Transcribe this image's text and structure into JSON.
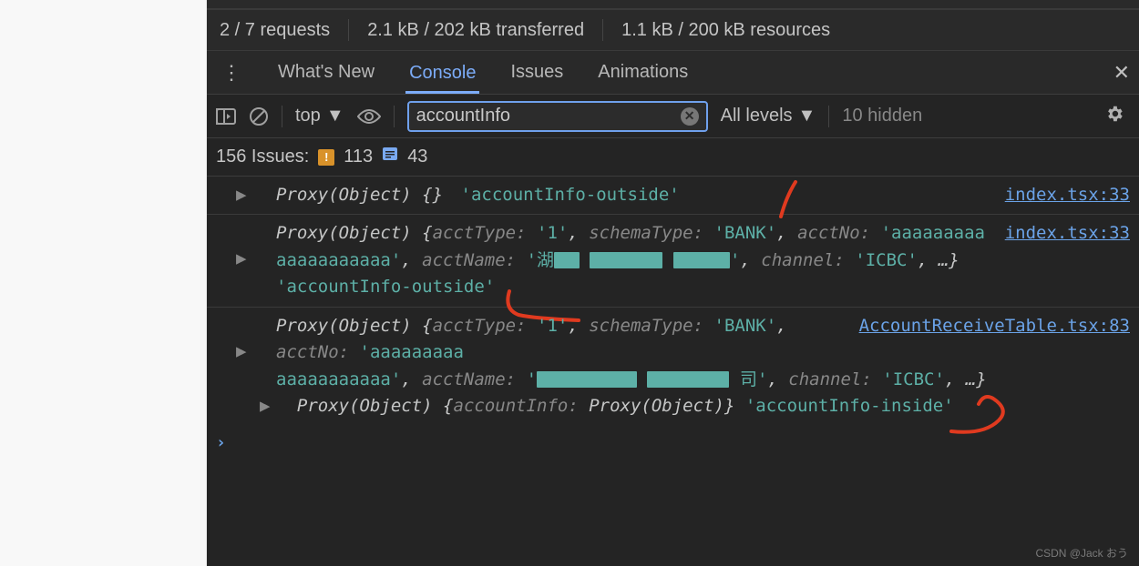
{
  "network_summary": {
    "requests": "2 / 7 requests",
    "transferred": "2.1 kB / 202 kB transferred",
    "resources": "1.1 kB / 200 kB resources"
  },
  "tabs": {
    "whats_new": "What's New",
    "console": "Console",
    "issues": "Issues",
    "animations": "Animations"
  },
  "toolbar": {
    "context": "top",
    "filter_value": "accountInfo",
    "levels": "All levels",
    "hidden": "10 hidden"
  },
  "issues_bar": {
    "label": "156 Issues:",
    "warn_count": "113",
    "info_count": "43"
  },
  "logs": {
    "row1": {
      "proxy": "Proxy(Object) ",
      "braces": "{}",
      "tag": "'accountInfo-outside'",
      "src": "index.tsx:33"
    },
    "row2": {
      "src": "index.tsx:33",
      "proxy": "Proxy(Object) ",
      "open": "{",
      "k_acctType": "acctType:",
      "v_acctType": "'1'",
      "k_schemaType": "schemaType:",
      "v_schemaType": "'BANK'",
      "k_acctNo": "acctNo:",
      "v_acctNo1": "'aaaaaaaaa",
      "v_acctNo2": "aaaaaaaaaaa'",
      "k_acctName": "acctName:",
      "v_acctName_q": "'湖",
      "k_channel": "channel:",
      "v_channel": "'ICBC'",
      "ellipsis": "…}",
      "tag": "'accountInfo-outside'"
    },
    "row3": {
      "src": "AccountReceiveTable.tsx:83",
      "proxy": "Proxy(Object) ",
      "open": "{",
      "k_acctType": "acctType:",
      "v_acctType": "'1'",
      "k_schemaType": "schemaType:",
      "v_schemaType": "'BANK'",
      "k_acctNo": "acctNo:",
      "v_acctNo1": "'aaaaaaaaa",
      "v_acctNo2": "aaaaaaaaaaa'",
      "k_acctName": "acctName:",
      "v_acctName_q": "'",
      "v_acctName_suf": "司'",
      "k_channel": "channel:",
      "v_channel": "'ICBC'",
      "ellipsis": "…}",
      "proxy2": "Proxy(Object) ",
      "open2": "{",
      "k_ai": "accountInfo:",
      "v_ai": "Proxy(Object)",
      "close2": "}",
      "tag": "'accountInfo-inside'"
    }
  },
  "watermark": "CSDN @Jack おう"
}
